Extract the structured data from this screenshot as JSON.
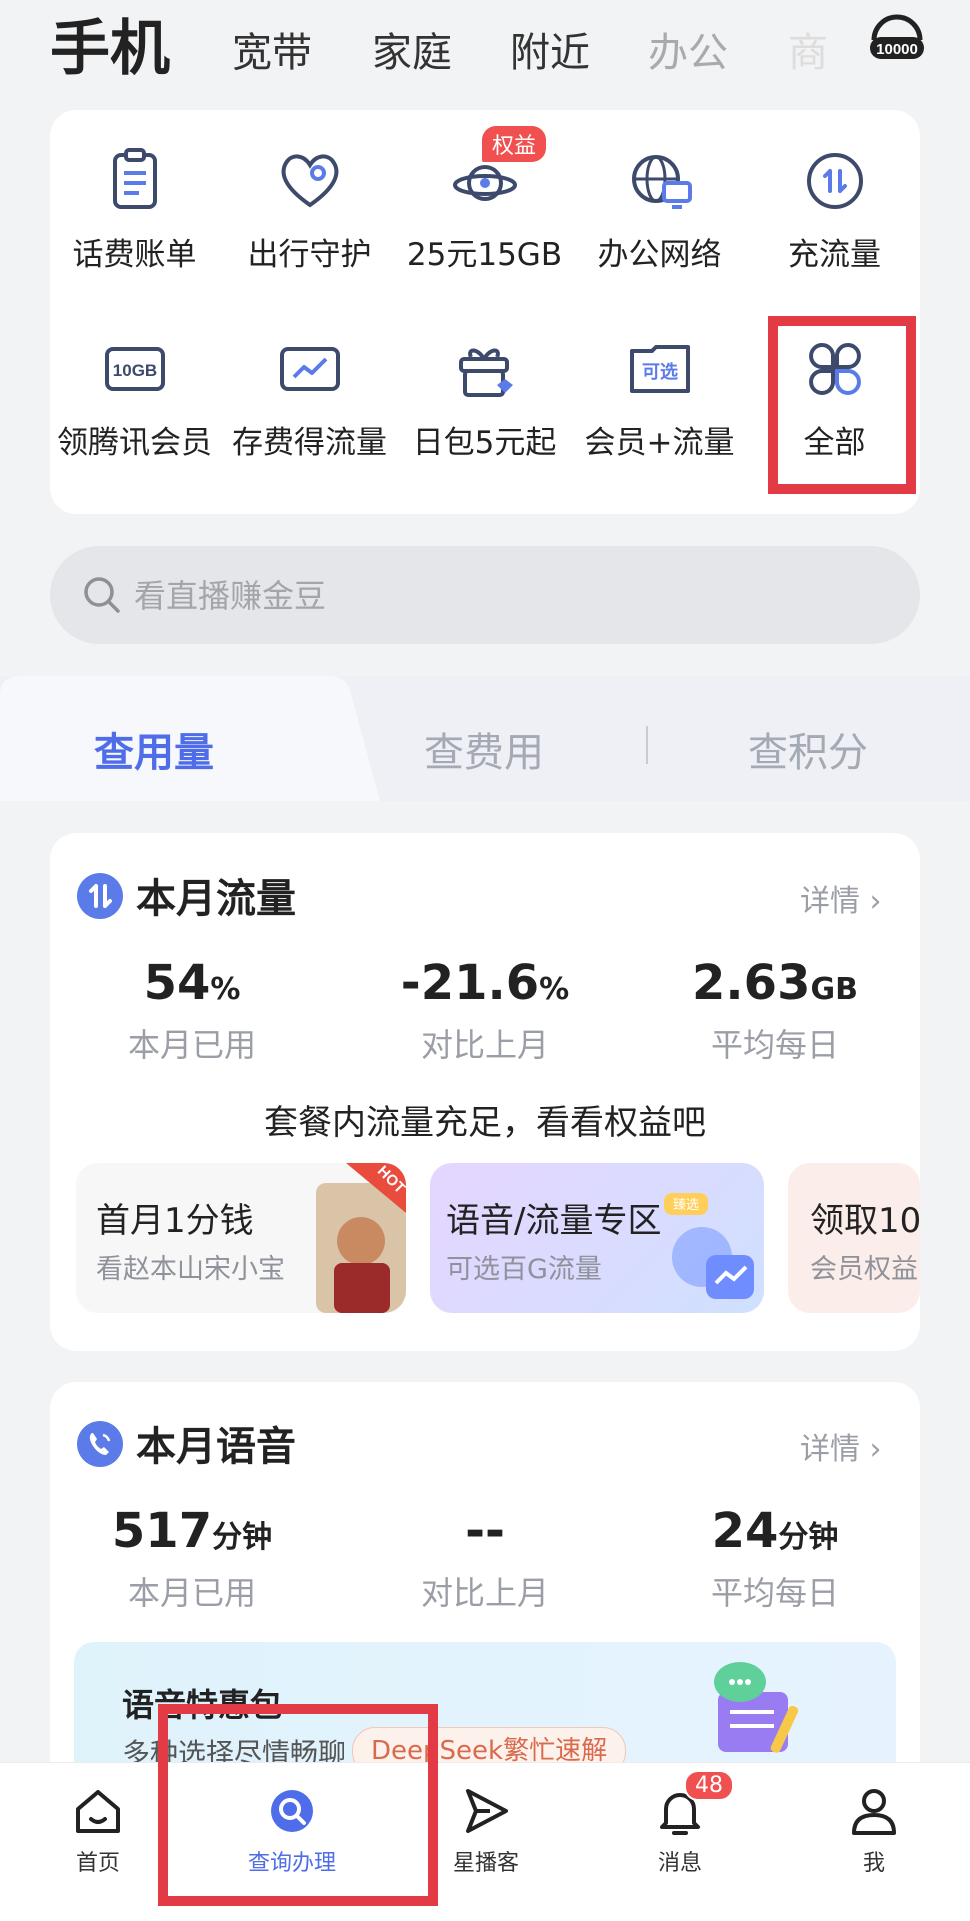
{
  "top_tabs": [
    "手机",
    "宽带",
    "家庭",
    "附近",
    "办公",
    "商"
  ],
  "brand_icon": "10000-logo-icon",
  "services": [
    {
      "label": "话费账单",
      "icon": "bill-icon"
    },
    {
      "label": "出行守护",
      "icon": "heart-location-icon"
    },
    {
      "label": "25元15GB",
      "icon": "planet-icon",
      "badge": "权益"
    },
    {
      "label": "办公网络",
      "icon": "globe-monitor-icon"
    },
    {
      "label": "充流量",
      "icon": "data-transfer-icon"
    },
    {
      "label": "领腾讯会员",
      "icon": "10gb-card-icon",
      "icon_text": "10GB"
    },
    {
      "label": "存费得流量",
      "icon": "chart-card-icon"
    },
    {
      "label": "日包5元起",
      "icon": "gift-icon"
    },
    {
      "label": "会员+流量",
      "icon": "optional-card-icon",
      "icon_text": "可选"
    },
    {
      "label": "全部",
      "icon": "all-grid-icon"
    }
  ],
  "search": {
    "placeholder": "看直播赚金豆"
  },
  "segments": [
    "查用量",
    "查费用",
    "查积分"
  ],
  "data_usage": {
    "title": "本月流量",
    "detail": "详情",
    "stats": [
      {
        "value": "54",
        "unit": "%",
        "label": "本月已用"
      },
      {
        "value": "-21.6",
        "unit": "%",
        "label": "对比上月"
      },
      {
        "value": "2.63",
        "unit": "GB",
        "label": "平均每日"
      }
    ],
    "notice": "套餐内流量充足，看看权益吧",
    "promos": [
      {
        "title": "首月1分钱",
        "sub": "看赵本山宋小宝",
        "tag": "HOT"
      },
      {
        "title": "语音/流量专区",
        "sub": "可选百G流量",
        "tag": "臻选"
      },
      {
        "title": "领取10",
        "sub": "会员权益"
      }
    ]
  },
  "voice_usage": {
    "title": "本月语音",
    "detail": "详情",
    "stats": [
      {
        "value": "517",
        "unit": "分钟",
        "label": "本月已用"
      },
      {
        "value": "--",
        "unit": "",
        "label": "对比上月"
      },
      {
        "value": "24",
        "unit": "分钟",
        "label": "平均每日"
      }
    ],
    "banner": {
      "title": "语音特惠包",
      "sub": "多种选择尽情畅聊"
    }
  },
  "deepseek_chip": "DeepSeek繁忙速解",
  "bottom_nav": [
    {
      "label": "首页",
      "icon": "home-icon"
    },
    {
      "label": "查询办理",
      "icon": "query-icon"
    },
    {
      "label": "星播客",
      "icon": "send-icon"
    },
    {
      "label": "消息",
      "icon": "bell-icon",
      "badge": "48"
    },
    {
      "label": "我",
      "icon": "user-icon"
    }
  ],
  "colors": {
    "accent": "#4f6de8",
    "highlight": "#e33b45",
    "badge": "#f0504f"
  }
}
